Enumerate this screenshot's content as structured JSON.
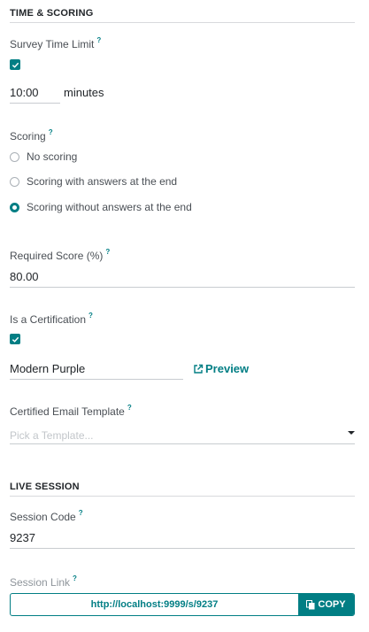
{
  "time_scoring": {
    "title": "TIME & SCORING",
    "time_limit_label": "Survey Time Limit",
    "time_limit_help": "?",
    "time_limit_checked": true,
    "time_value": "10:00",
    "time_unit": "minutes",
    "scoring_label": "Scoring",
    "scoring_help": "?",
    "scoring_options": [
      {
        "label": "No scoring",
        "selected": false
      },
      {
        "label": "Scoring with answers at the end",
        "selected": false
      },
      {
        "label": "Scoring without answers at the end",
        "selected": true
      }
    ],
    "required_score_label": "Required Score (%)",
    "required_score_help": "?",
    "required_score_value": "80.00",
    "certification_label": "Is a Certification",
    "certification_help": "?",
    "certification_checked": true,
    "certification_template": "Modern Purple",
    "preview_label": "Preview",
    "email_template_label": "Certified Email Template",
    "email_template_help": "?",
    "email_template_placeholder": "Pick a Template..."
  },
  "live_session": {
    "title": "LIVE SESSION",
    "session_code_label": "Session Code",
    "session_code_help": "?",
    "session_code_value": "9237",
    "session_link_label": "Session Link",
    "session_link_help": "?",
    "session_link_url": "http://localhost:9999/s/9237",
    "copy_label": "COPY"
  },
  "colors": {
    "accent": "#017e84",
    "text": "#212529",
    "muted": "#8f959b"
  }
}
